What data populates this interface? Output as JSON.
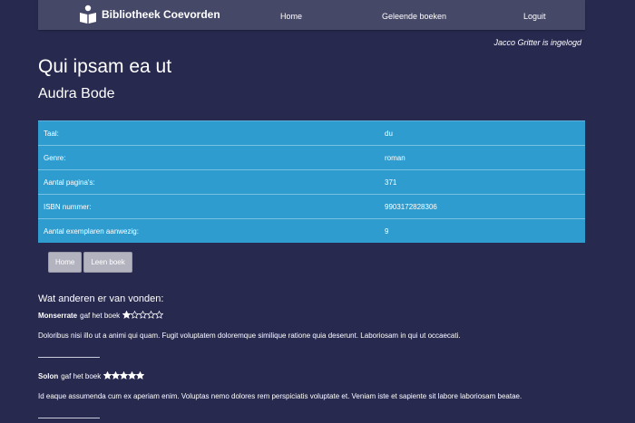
{
  "nav": {
    "brand": "Bibliotheek Coevorden",
    "brand_icon": "book-reader-icon",
    "links": [
      "Home",
      "Geleende boeken",
      "Loguit"
    ]
  },
  "login_note": "Jacco Gritter is ingelogd",
  "book": {
    "title": "Qui ipsam ea ut",
    "author": "Audra Bode",
    "details": [
      {
        "label": "Taal:",
        "value": "du"
      },
      {
        "label": "Genre:",
        "value": "roman"
      },
      {
        "label": "Aantal pagina's:",
        "value": "371"
      },
      {
        "label": "ISBN nummer:",
        "value": "9903172828306"
      },
      {
        "label": "Aantal exemplaren aanwezig:",
        "value": "9"
      }
    ]
  },
  "buttons": {
    "home": "Home",
    "borrow": "Leen boek"
  },
  "reviews_heading": "Wat anderen er van vonden:",
  "reviews": [
    {
      "name": "Monserrate",
      "suffix": "gaf het boek",
      "rating": 1,
      "max": 5,
      "text": "Doloribus nisi illo ut a animi qui quam. Fugit voluptatem doloremque similique ratione quia deserunt. Laboriosam in qui ut occaecati."
    },
    {
      "name": "Solon",
      "suffix": "gaf het boek",
      "rating": 5,
      "max": 5,
      "text": "Id eaque assumenda cum ex aperiam enim. Voluptas nemo dolores rem perspiciatis voluptate et. Veniam iste et sapiente sit labore laboriosam beatae."
    }
  ],
  "colors": {
    "background": "#27294f",
    "navbar": "#464868",
    "table": "#2e9ccf",
    "button": "#b3b3c0"
  }
}
